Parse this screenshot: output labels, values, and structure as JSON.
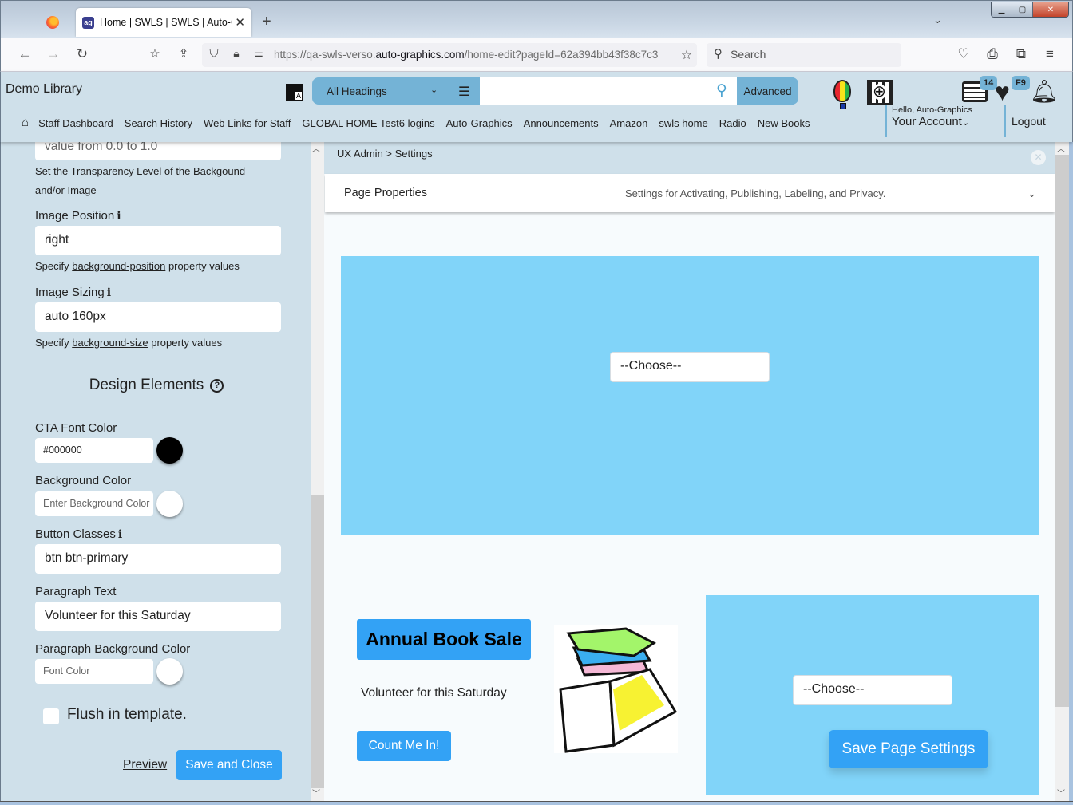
{
  "browser": {
    "tab_title": "Home | SWLS | SWLS | Auto-Gra",
    "url_prefix": "https://qa-swls-verso.",
    "url_domain": "auto-graphics.com",
    "url_suffix": "/home-edit?pageId=62a394bb43f38c7c3",
    "search_placeholder": "Search",
    "new_tab": "+",
    "tab_close": "✕"
  },
  "header": {
    "library_name": "Demo Library",
    "search_scope": "All Headings",
    "search_value": "",
    "advanced_label": "Advanced",
    "list_badge": "14",
    "favorites_badge": "F9",
    "greeting": "Hello, Auto-Graphics",
    "account_label": "Your Account",
    "logout_label": "Logout",
    "nav_links": [
      "Staff Dashboard",
      "Search History",
      "Web Links for Staff",
      "GLOBAL HOME Test6 logins",
      "Auto-Graphics",
      "Announcements",
      "Amazon",
      "swls home",
      "Radio",
      "New Books"
    ]
  },
  "left_panel": {
    "transparency_placeholder": "value from 0.0 to 1.0",
    "transparency_help": "Set the Transparency Level of the Backgound and/or Image",
    "image_position_label": "Image Position",
    "image_position_value": "right",
    "image_position_help_pre": "Specify ",
    "image_position_help_link": "background-position",
    "image_position_help_post": " property values",
    "image_sizing_label": "Image Sizing",
    "image_sizing_value": "auto 160px",
    "image_sizing_help_pre": "Specify ",
    "image_sizing_help_link": "background-size",
    "image_sizing_help_post": " property values",
    "design_elements_title": "Design Elements",
    "cta_font_color_label": "CTA Font Color",
    "cta_font_color_value": "#000000",
    "cta_font_color_swatch": "#000000",
    "background_color_label": "Background Color",
    "background_color_placeholder": "Enter Background Color",
    "background_color_swatch": "#ffffff",
    "button_classes_label": "Button Classes",
    "button_classes_value": "btn btn-primary",
    "paragraph_text_label": "Paragraph Text",
    "paragraph_text_value": "Volunteer for this Saturday",
    "paragraph_bg_label": "Paragraph Background Color",
    "paragraph_bg_placeholder": "Font Color",
    "paragraph_bg_swatch": "#ffffff",
    "flush_label": "Flush in template.",
    "flush_checked": false,
    "preview_label": "Preview",
    "save_close_label": "Save and Close"
  },
  "main": {
    "breadcrumb": "UX Admin > Settings",
    "page_properties_title": "Page Properties",
    "page_properties_desc": "Settings for Activating, Publishing, Labeling, and Privacy.",
    "choose_top": "--Choose--",
    "choose_bottom": "--Choose--",
    "cta_title": "Annual Book Sale",
    "cta_paragraph": "Volunteer for this Saturday",
    "cta_button": "Count Me In!",
    "save_page_settings": "Save Page Settings"
  },
  "colors": {
    "panel_bg": "#cfe0ea",
    "block_bg": "#81d4f9",
    "primary": "#33a2f5",
    "header_accent": "#74b3d6"
  }
}
